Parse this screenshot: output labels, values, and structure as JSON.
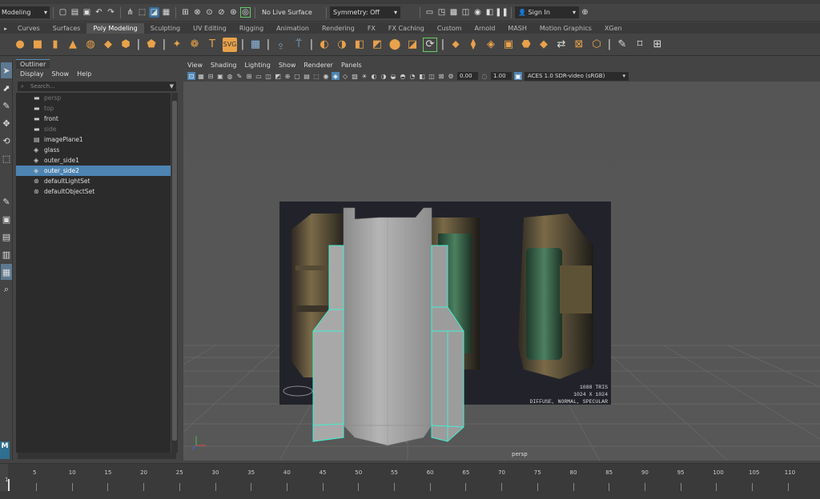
{
  "status": {
    "mode": "Modeling",
    "live_surface": "No Live Surface",
    "symmetry": "Symmetry: Off",
    "sign_in": "Sign In"
  },
  "shelf_tabs": [
    "Curves",
    "Surfaces",
    "Poly Modeling",
    "Sculpting",
    "UV Editing",
    "Rigging",
    "Animation",
    "Rendering",
    "FX",
    "FX Caching",
    "Custom",
    "Arnold",
    "MASH",
    "Motion Graphics",
    "XGen"
  ],
  "shelf_tab_active": "Poly Modeling",
  "outliner": {
    "title": "Outliner",
    "menu": [
      "Display",
      "Show",
      "Help"
    ],
    "search_placeholder": "Search...",
    "items": [
      {
        "label": "persp",
        "icon": "camera-icon",
        "dim": true
      },
      {
        "label": "top",
        "icon": "camera-icon",
        "dim": true
      },
      {
        "label": "front",
        "icon": "camera-icon",
        "dim": false
      },
      {
        "label": "side",
        "icon": "camera-icon",
        "dim": true
      },
      {
        "label": "imagePlane1",
        "icon": "image-plane-icon",
        "dim": false
      },
      {
        "label": "glass",
        "icon": "mesh-icon",
        "dim": false
      },
      {
        "label": "outer_side1",
        "icon": "mesh-icon",
        "dim": false
      },
      {
        "label": "outer_side2",
        "icon": "mesh-icon",
        "dim": false,
        "selected": true
      },
      {
        "label": "defaultLightSet",
        "icon": "set-icon",
        "dim": false
      },
      {
        "label": "defaultObjectSet",
        "icon": "set-icon",
        "dim": false
      }
    ]
  },
  "viewport": {
    "menu": [
      "View",
      "Shading",
      "Lighting",
      "Show",
      "Renderer",
      "Panels"
    ],
    "exposure": "0.00",
    "gamma": "1.00",
    "color_space": "ACES 1.0 SDR-video (sRGB)",
    "camera": "persp",
    "texture_text": [
      "1088 TRIS",
      "1024 X 1024",
      "DIFFUSE, NORMAL, SPECULAR"
    ]
  },
  "timeline": {
    "start": 1,
    "labels": [
      "5",
      "10",
      "15",
      "20",
      "25",
      "30",
      "35",
      "40",
      "45",
      "50",
      "55",
      "60",
      "65",
      "70",
      "75",
      "80",
      "85",
      "90",
      "95",
      "100",
      "105",
      "110"
    ],
    "current_frame": "1"
  },
  "logo": "M"
}
